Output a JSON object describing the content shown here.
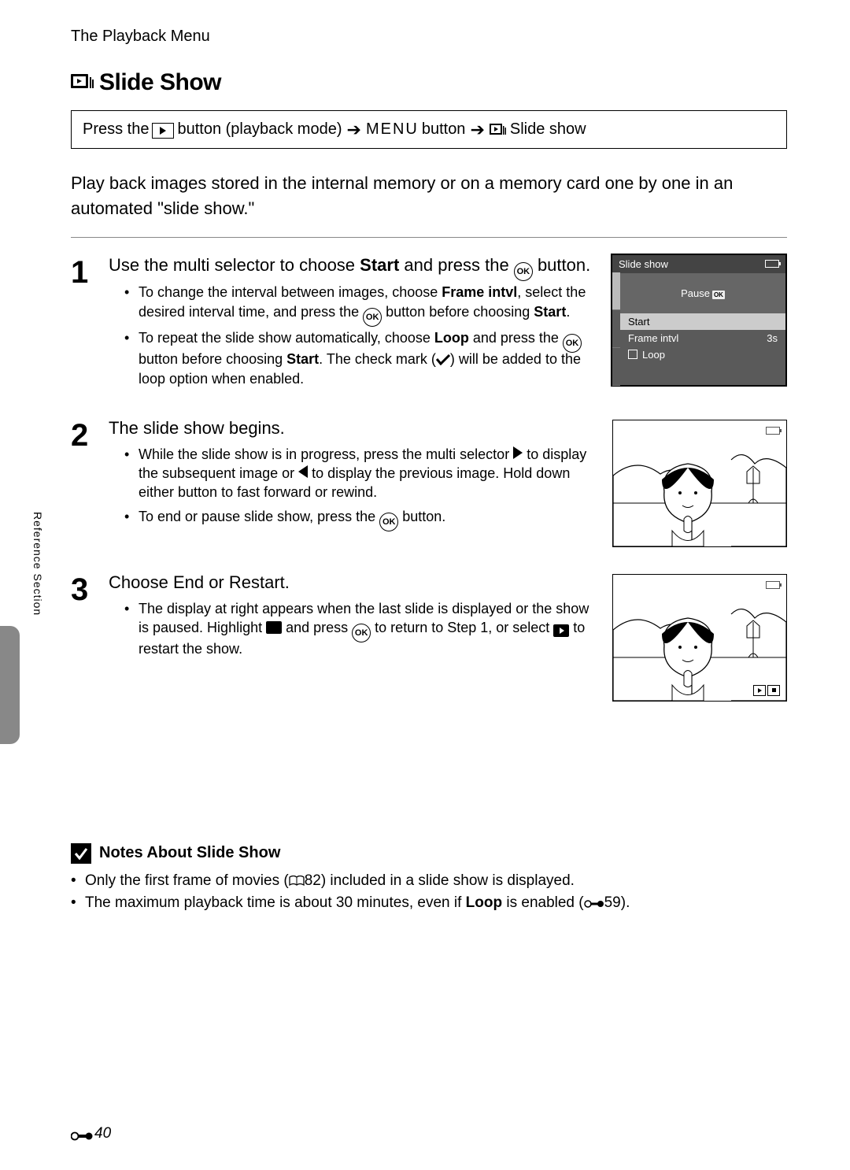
{
  "header": {
    "section": "The Playback Menu"
  },
  "title": "Slide Show",
  "nav": {
    "press_the": "Press the",
    "playback_mode": " button (playback mode)",
    "menu": "MENU",
    "button_word": " button",
    "slide_show": " Slide show"
  },
  "intro": "Play back images stored in the internal memory or on a memory card one by one in an automated \"slide show.\"",
  "steps": [
    {
      "num": "1",
      "heading_pre": "Use the multi selector to choose ",
      "heading_bold": "Start",
      "heading_post": " and press the ",
      "heading_tail": " button.",
      "bullets": [
        {
          "pre": "To change the interval between images, choose ",
          "b1": "Frame intvl",
          "mid": ", select the desired interval time, and press the ",
          "post": " button before choosing ",
          "b2": "Start",
          "end": "."
        },
        {
          "pre": "To repeat the slide show automatically, choose ",
          "b1": "Loop",
          "mid": " and press the ",
          "post": " button before choosing ",
          "b2": "Start",
          "end2": ". The check mark (",
          "end3": ") will be added to the loop option when enabled."
        }
      ],
      "screen": {
        "title": "Slide show",
        "pause": "Pause",
        "start": "Start",
        "frame": "Frame intvl",
        "frame_val": "3s",
        "loop": "Loop"
      }
    },
    {
      "num": "2",
      "heading": "The slide show begins.",
      "bullets": [
        {
          "pre": "While the slide show is in progress, press the multi selector ",
          "mid": " to display the subsequent image or ",
          "post": " to display the previous image. Hold down either button to fast forward or rewind."
        },
        {
          "pre": "To end or pause slide show, press the ",
          "post": " button."
        }
      ]
    },
    {
      "num": "3",
      "heading": "Choose End or Restart.",
      "bullets": [
        {
          "pre": "The display at right appears when the last slide is displayed or the show is paused. Highlight ",
          "mid": " and press ",
          "mid2": " to return to Step 1, or select ",
          "post": " to restart the show."
        }
      ]
    }
  ],
  "side_label": "Reference Section",
  "notes": {
    "title": "Notes About Slide Show",
    "items": [
      {
        "pre": "Only the first frame of movies (",
        "ref": "82",
        "post": ") included in a slide show is displayed."
      },
      {
        "pre": "The maximum playback time is about 30 minutes, even if ",
        "b": "Loop",
        "mid": " is enabled (",
        "ref": "59",
        "post": ")."
      }
    ]
  },
  "footer_page": "40"
}
